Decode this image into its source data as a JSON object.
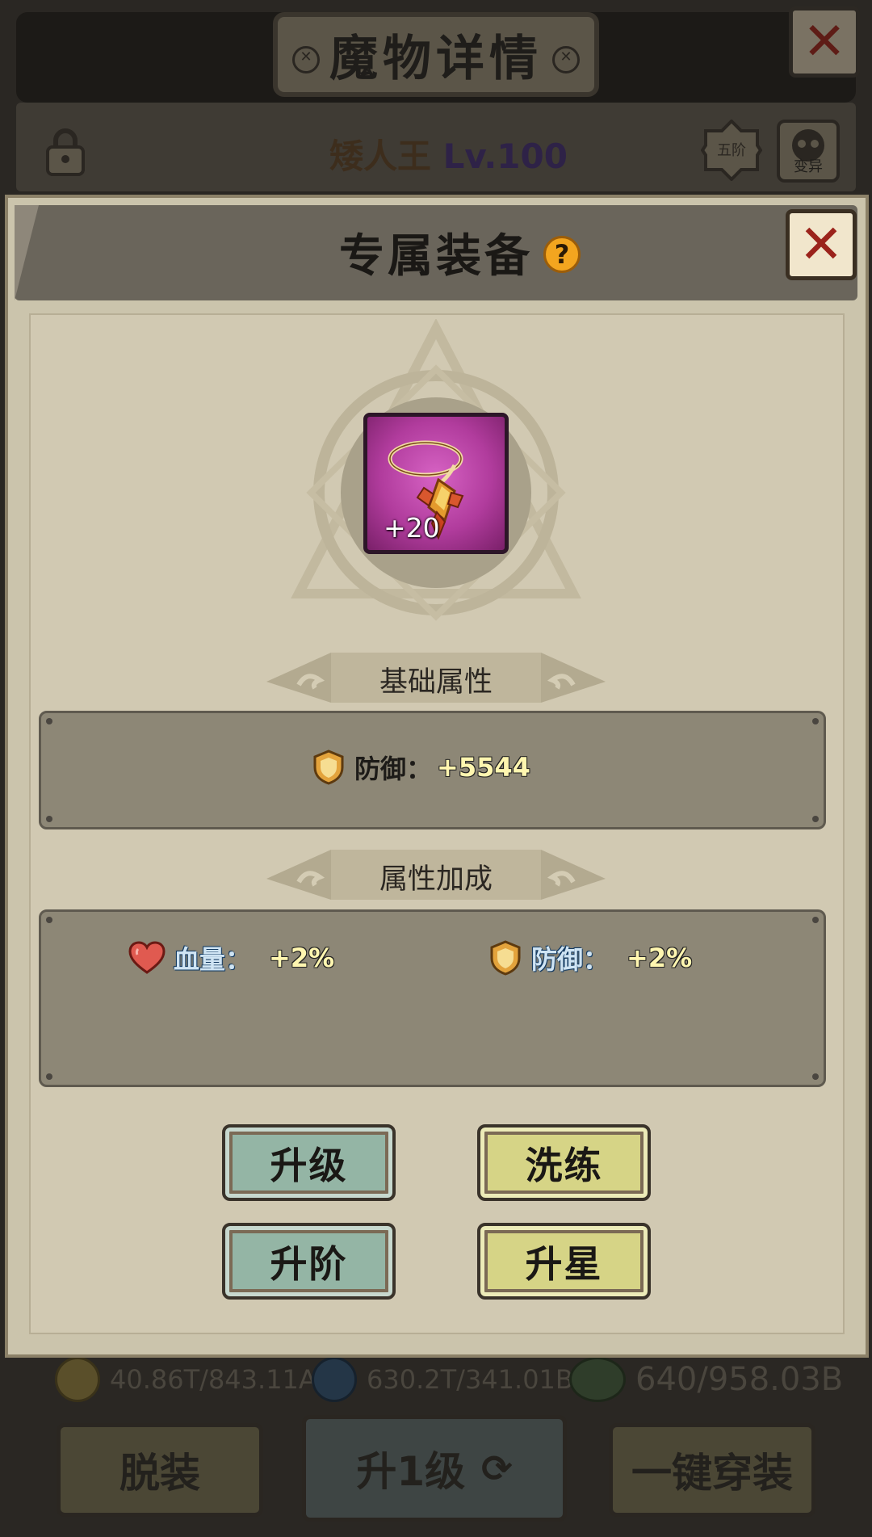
{
  "background_window": {
    "title": "魔物详情",
    "monster_name": "矮人王",
    "monster_level": "Lv.100",
    "tier_badge": "五阶",
    "mutate_label": "变异",
    "resources": [
      {
        "icon": "gold-coin-icon",
        "text": "40.86T/843.11AA"
      },
      {
        "icon": "blue-orb-icon",
        "text": "630.2T/341.01BB"
      },
      {
        "icon": "green-gem-icon",
        "text": "640/958.03B"
      }
    ],
    "buttons": {
      "unequip": "脱装",
      "upgrade_one": "升1级",
      "equip_all": "一键穿装"
    }
  },
  "modal": {
    "title": "专属装备",
    "help_glyph": "?",
    "close_glyph": "✕",
    "item": {
      "icon": "necklace-icon",
      "enhance_level": "+20"
    },
    "base_attributes": {
      "heading": "基础属性",
      "stats": [
        {
          "icon": "shield-icon",
          "label": "防御：",
          "value": "+5544"
        }
      ]
    },
    "attribute_bonus": {
      "heading": "属性加成",
      "stats": [
        {
          "icon": "heart-icon",
          "label": "血量：",
          "value": "+2%"
        },
        {
          "icon": "shield-icon",
          "label": "防御：",
          "value": "+2%"
        }
      ]
    },
    "actions": {
      "upgrade": "升级",
      "refine": "洗练",
      "advance": "升阶",
      "star_up": "升星"
    }
  },
  "colors": {
    "modal_bg": "#cbc4ac",
    "title_bar": "#6a655b",
    "panel": "#8d8776",
    "item_rarity": "#b13c9d",
    "button_teal": "#94b5a5",
    "button_yellow": "#d6d486",
    "close_x": "#9b231b",
    "help_icon": "#f3a51f"
  }
}
